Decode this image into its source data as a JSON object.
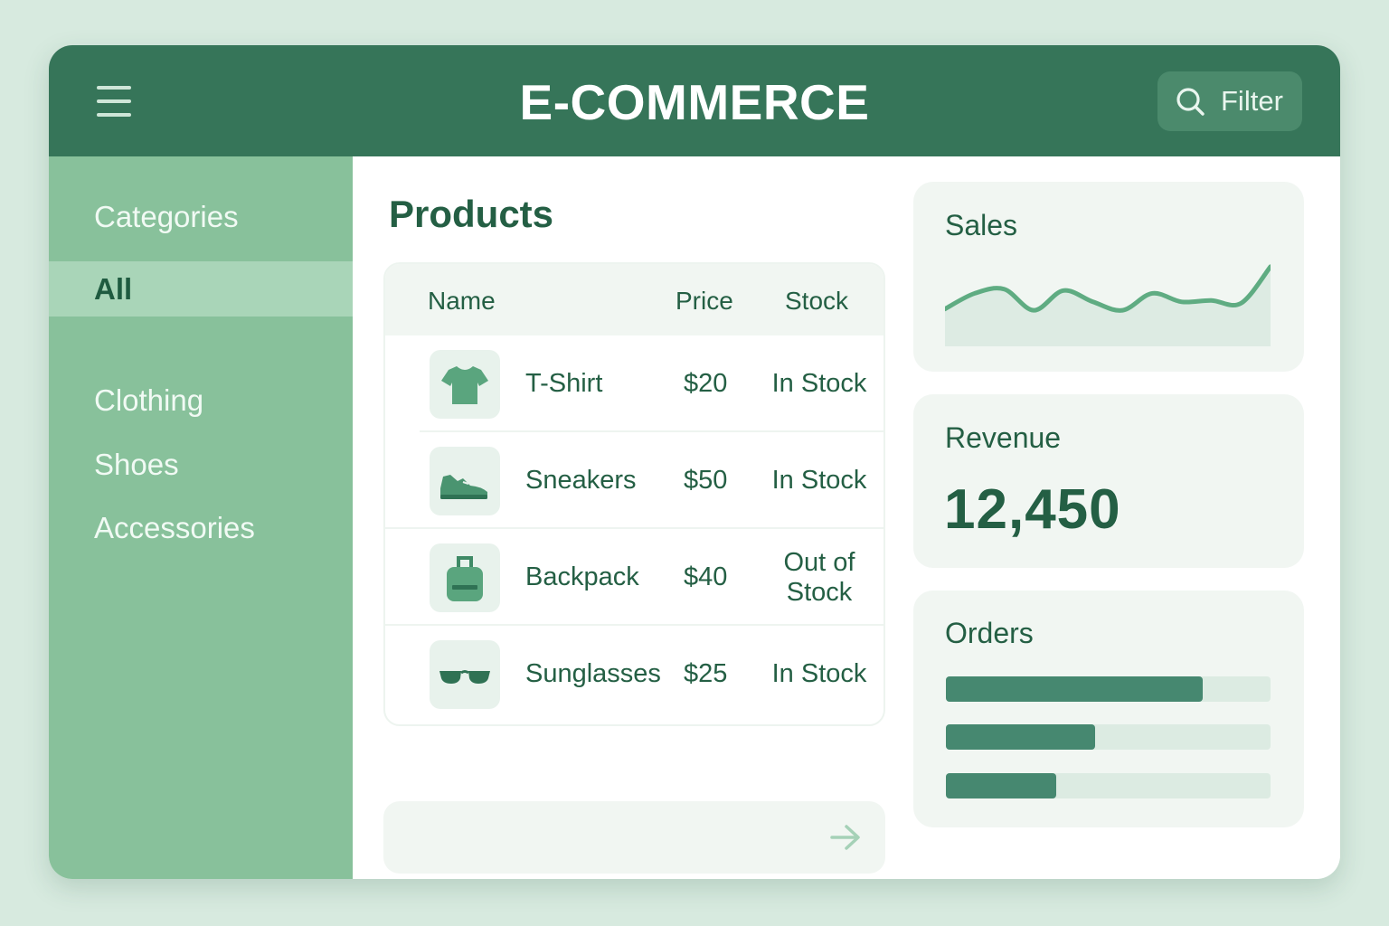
{
  "header": {
    "title": "E-COMMERCE",
    "filter_label": "Filter"
  },
  "sidebar": {
    "heading": "Categories",
    "items": [
      {
        "label": "All",
        "active": true
      },
      {
        "label": "Clothing",
        "active": false
      },
      {
        "label": "Shoes",
        "active": false
      },
      {
        "label": "Accessories",
        "active": false
      }
    ]
  },
  "products": {
    "title": "Products",
    "columns": [
      "Name",
      "Price",
      "Stock"
    ],
    "rows": [
      {
        "icon": "tshirt-icon",
        "name": "T-Shirt",
        "price": "$20",
        "stock": "In Stock"
      },
      {
        "icon": "sneaker-icon",
        "name": "Sneakers",
        "price": "$50",
        "stock": "In Stock"
      },
      {
        "icon": "backpack-icon",
        "name": "Backpack",
        "price": "$40",
        "stock": "Out of Stock"
      },
      {
        "icon": "sunglasses-icon",
        "name": "Sunglasses",
        "price": "$25",
        "stock": "In Stock"
      }
    ]
  },
  "sales": {
    "title": "Sales",
    "sparkline": [
      30,
      52,
      58,
      28,
      56,
      40,
      28,
      52,
      40,
      42,
      38,
      90
    ]
  },
  "revenue": {
    "title": "Revenue",
    "value": "12,450"
  },
  "orders": {
    "title": "Orders",
    "bars": [
      0.79,
      0.46,
      0.34
    ]
  },
  "colors": {
    "header": "#367559",
    "sidebar": "#88c19b",
    "accent": "#468870",
    "text": "#245f44"
  }
}
